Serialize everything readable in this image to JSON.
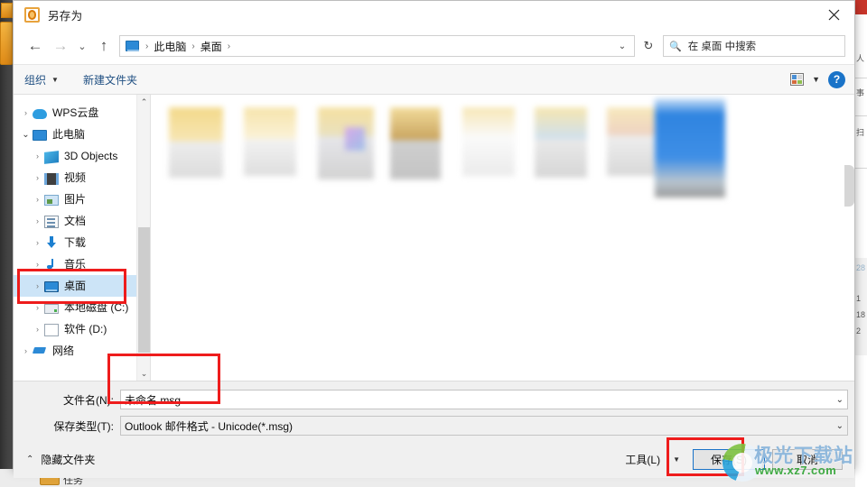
{
  "window": {
    "title": "另存为",
    "app_icon": "outlook-icon",
    "close_label": "✕"
  },
  "nav": {
    "back": "←",
    "forward": "→",
    "recent": "⌄",
    "up": "↑",
    "breadcrumb": [
      {
        "label": "此电脑"
      },
      {
        "label": "桌面"
      }
    ],
    "separator": "›",
    "dropdown_caret": "⌄",
    "refresh": "↻"
  },
  "search": {
    "icon": "search-icon",
    "placeholder": "在 桌面 中搜索"
  },
  "toolbar": {
    "organize_label": "组织",
    "organize_caret": "▼",
    "new_folder_label": "新建文件夹",
    "view_caret": "▼",
    "help_label": "?"
  },
  "sidebar": {
    "items": [
      {
        "label": "WPS云盘",
        "twisty": "›",
        "icon": "cloud-icon",
        "indent": 1,
        "selected": false
      },
      {
        "label": "此电脑",
        "twisty": "⌄",
        "icon": "pc-icon",
        "indent": 1,
        "selected": false
      },
      {
        "label": "3D Objects",
        "twisty": "›",
        "icon": "cube-icon",
        "indent": 2,
        "selected": false
      },
      {
        "label": "视频",
        "twisty": "›",
        "icon": "video-icon",
        "indent": 2,
        "selected": false
      },
      {
        "label": "图片",
        "twisty": "›",
        "icon": "picture-icon",
        "indent": 2,
        "selected": false
      },
      {
        "label": "文档",
        "twisty": "›",
        "icon": "document-icon",
        "indent": 2,
        "selected": false
      },
      {
        "label": "下载",
        "twisty": "›",
        "icon": "download-icon",
        "indent": 2,
        "selected": false
      },
      {
        "label": "音乐",
        "twisty": "›",
        "icon": "music-icon",
        "indent": 2,
        "selected": false
      },
      {
        "label": "桌面",
        "twisty": "›",
        "icon": "desktop-icon",
        "indent": 2,
        "selected": true
      },
      {
        "label": "本地磁盘 (C:)",
        "twisty": "›",
        "icon": "disk-icon",
        "indent": 2,
        "selected": false
      },
      {
        "label": "软件 (D:)",
        "twisty": "›",
        "icon": "file-icon",
        "indent": 2,
        "selected": false
      },
      {
        "label": "网络",
        "twisty": "›",
        "icon": "network-icon",
        "indent": 1,
        "selected": false
      }
    ],
    "scroll_up": "⌃",
    "scroll_down": "⌄"
  },
  "form": {
    "filename_label": "文件名(N):",
    "filename_value": "未命名.msg",
    "savetype_label": "保存类型(T):",
    "savetype_value": "Outlook 邮件格式 - Unicode(*.msg)",
    "caret": "⌄"
  },
  "footer": {
    "hide_folders_chevron": "⌃",
    "hide_folders_label": "隐藏文件夹",
    "tools_label": "工具(L)",
    "tools_caret": "▼",
    "save_label": "保存(S)",
    "cancel_label": "取消"
  },
  "watermark": {
    "main": "极光下载站",
    "sub": "www.xz7.com"
  },
  "annotations": {
    "desktop_highlight": "桌面",
    "filename_highlight": "文件名",
    "save_highlight": "保存(S)"
  },
  "background": {
    "text_fragments": [
      "人",
      "事",
      "扫",
      "28",
      "1",
      "18",
      "2"
    ],
    "tray_label": "任务"
  },
  "colors": {
    "accent": "#1a73c8",
    "annotation": "#ee1c1c",
    "selection": "#cce4f7",
    "link": "#1f4f82",
    "watermark_main": "#8fb8dc",
    "watermark_sub": "#3faa43"
  }
}
